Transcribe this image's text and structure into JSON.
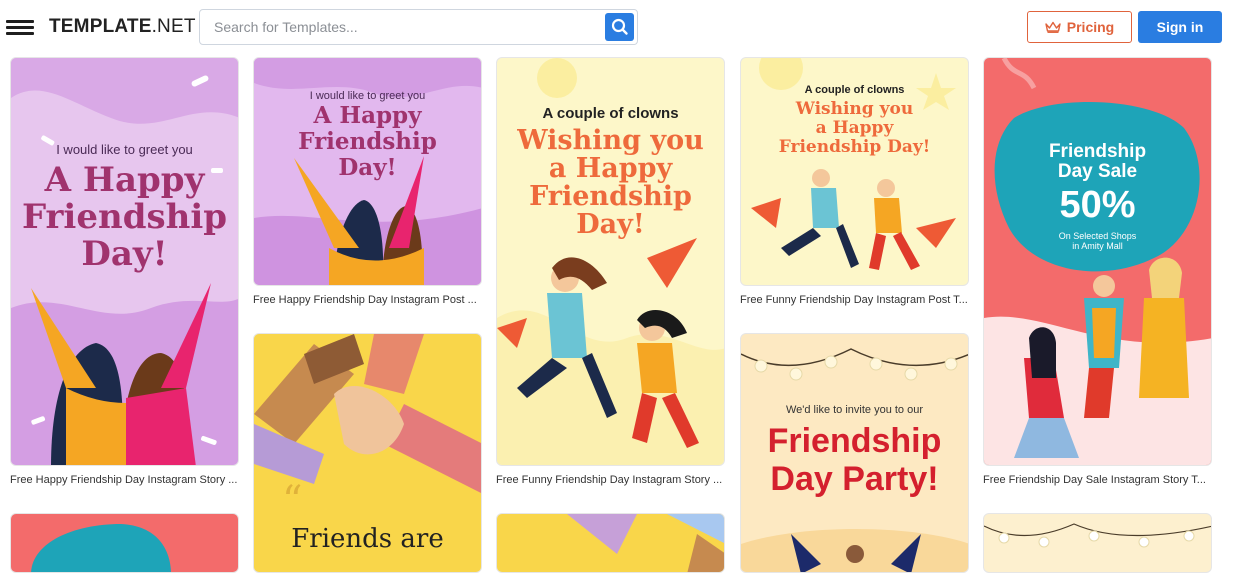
{
  "header": {
    "logo_bold": "TEMPLATE",
    "logo_rest": ".NET",
    "search_placeholder": "Search for Templates...",
    "pricing_label": "Pricing",
    "signin_label": "Sign in"
  },
  "colors": {
    "accent_blue": "#2a7de1",
    "accent_orange": "#e0633c"
  },
  "cards": [
    {
      "caption": "Free Happy Friendship Day Instagram Story ...",
      "line1": "I would like to greet you",
      "line2": "A Happy",
      "line3": "Friendship",
      "line4": "Day!"
    },
    {
      "caption": "Free Happy Friendship Day Instagram Post ...",
      "line1": "I would like to greet you",
      "line2": "A Happy",
      "line3": "Friendship",
      "line4": "Day!"
    },
    {
      "caption": "Free Funny Friendship Day Instagram Story ...",
      "line1": "A couple of clowns",
      "line2": "Wishing you",
      "line3": "a Happy",
      "line4": "Friendship",
      "line5": "Day!"
    },
    {
      "caption": "Free Funny Friendship Day Instagram Post T...",
      "line1": "A couple of clowns",
      "line2": "Wishing you",
      "line3": "a Happy",
      "line4": "Friendship Day!"
    },
    {
      "caption": "Free Friendship Day Sale Instagram Story T...",
      "line1": "Friendship",
      "line2": "Day Sale",
      "line3": "50%",
      "line4": "On Selected Shops",
      "line5": "in Amity Mall"
    },
    {
      "line1": "Friends are"
    },
    {
      "line1": "We'd like to invite you to our",
      "line2": "Friendship",
      "line3": "Day Party!"
    }
  ]
}
